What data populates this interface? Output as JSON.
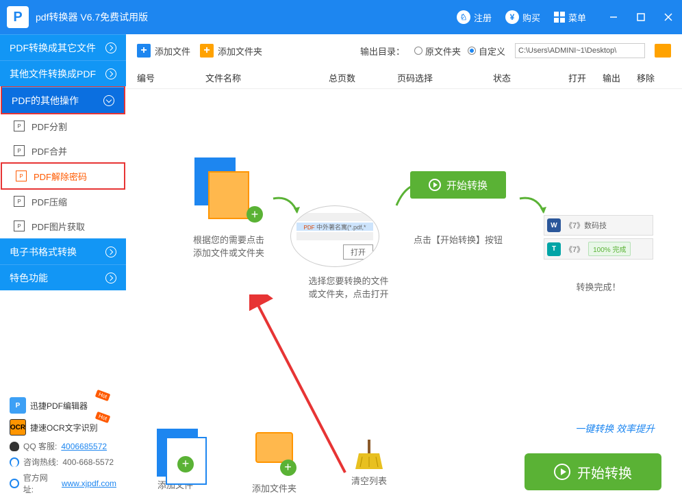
{
  "titlebar": {
    "app_title": "pdf转换器 V6.7免费试用版",
    "register": "注册",
    "buy": "购买",
    "menu": "菜单"
  },
  "sidebar": {
    "nav": [
      {
        "label": "PDF转换成其它文件"
      },
      {
        "label": "其他文件转换成PDF"
      },
      {
        "label": "PDF的其他操作"
      },
      {
        "label": "电子书格式转换"
      },
      {
        "label": "特色功能"
      }
    ],
    "sub": [
      {
        "label": "PDF分割"
      },
      {
        "label": "PDF合并"
      },
      {
        "label": "PDF解除密码"
      },
      {
        "label": "PDF压缩"
      },
      {
        "label": "PDF图片获取"
      }
    ],
    "promo1": "迅捷PDF编辑器",
    "promo2": "捷速OCR文字识别",
    "hot": "Hot",
    "qq_label": "QQ 客服:",
    "qq_value": "4006685572",
    "phone_label": "咨询热线:",
    "phone_value": "400-668-5572",
    "site_label": "官方网址:",
    "site_value": "www.xjpdf.com"
  },
  "toolbar": {
    "add_file": "添加文件",
    "add_folder": "添加文件夹",
    "output_label": "输出目录：",
    "radio_original": "原文件夹",
    "radio_custom": "自定义",
    "path": "C:\\Users\\ADMINI~1\\Desktop\\"
  },
  "table": {
    "col_num": "编号",
    "col_name": "文件名称",
    "col_pages": "总页数",
    "col_select": "页码选择",
    "col_status": "状态",
    "col_open": "打开",
    "col_output": "输出",
    "col_remove": "移除"
  },
  "tutorial": {
    "step1_l1": "根据您的需要点击",
    "step1_l2": "添加文件或文件夹",
    "step2_file": "中外著名寓(*.pdf,*",
    "step2_open": "打开",
    "step2_l1": "选择您要转换的文件",
    "step2_l2": "或文件夹，点击打开",
    "step3_btn": "开始转换",
    "step3_text": "点击【开始转换】按钮",
    "step4_f1": "《7》数码技",
    "step4_f2": "《7》",
    "step4_pct": "100% 完成",
    "step4_text": "转换完成！"
  },
  "bottom": {
    "add_file": "添加文件",
    "add_folder": "添加文件夹",
    "clear": "清空列表",
    "promo": "一键转换 效率提升",
    "start": "开始转换"
  }
}
